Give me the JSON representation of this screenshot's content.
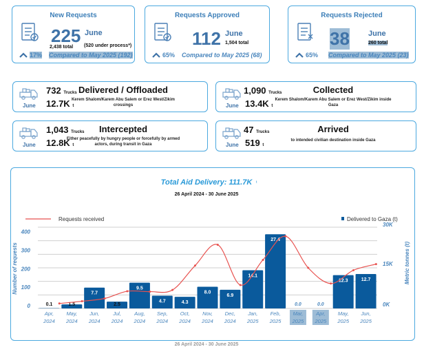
{
  "kpis": [
    {
      "title": "New Requests",
      "value": "225",
      "month": "June",
      "total": "2,438 total",
      "note": "(520 under process*)",
      "pct": "17%",
      "compare": "Compared to May 2025 (192)",
      "icon": "documents-check-icon"
    },
    {
      "title": "Requests Approved",
      "value": "112",
      "month": "June",
      "total": "1,504 total",
      "note": "",
      "pct": "65%",
      "compare": "Compared to May 2025 (68)",
      "icon": "document-magnifier-check-icon"
    },
    {
      "title": "Requests Rejected",
      "value": "38",
      "month": "June",
      "total": "260 total",
      "note": "",
      "pct": "65%",
      "compare": "Compared to May 2025 (23)",
      "icon": "scroll-x-icon"
    }
  ],
  "trucks": [
    {
      "title": "Delivered / Offloaded",
      "trucks": "732",
      "trucks_unit": "Trucks",
      "tonnes": "12.7K",
      "tonnes_unit": "t",
      "month": "June",
      "desc": "Kerem Shalom/Karem Abu Salem or Erez West/Zikim crossings"
    },
    {
      "title": "Collected",
      "trucks": "1,090",
      "trucks_unit": "Trucks",
      "tonnes": "13.4K",
      "tonnes_unit": "t",
      "month": "June",
      "desc": "Kerem Shalom/Karem Abu Salem or Erez West/Zikim inside Gaza"
    },
    {
      "title": "Intercepted",
      "trucks": "1,043",
      "trucks_unit": "Trucks",
      "tonnes": "12.8K",
      "tonnes_unit": "t",
      "month": "June",
      "desc": "Either peacefully by hungry people or forcefully by armed actors, during transit in Gaza"
    },
    {
      "title": "Arrived",
      "trucks": "47",
      "trucks_unit": "Trucks",
      "tonnes": "519",
      "tonnes_unit": "t",
      "month": "June",
      "desc": "to intended civilian destination inside Gaza"
    }
  ],
  "chart_data": {
    "type": "bar",
    "title": "Total Aid Delivery:  111.7K",
    "title_unit": "t",
    "subtitle": "26 April 2024 - 30 June 2025",
    "footer": "26 April 2024 - 30 June 2025",
    "categories": [
      [
        "Apr,",
        "2024"
      ],
      [
        "May,",
        "2024"
      ],
      [
        "Jun,",
        "2024"
      ],
      [
        "Jul,",
        "2024"
      ],
      [
        "Aug,",
        "2024"
      ],
      [
        "Sep,",
        "2024"
      ],
      [
        "Oct,",
        "2024"
      ],
      [
        "Nov,",
        "2024"
      ],
      [
        "Dec,",
        "2024"
      ],
      [
        "Jan,",
        "2025"
      ],
      [
        "Feb,",
        "2025"
      ],
      [
        "Mar,",
        "2025"
      ],
      [
        "Apr,",
        "2025"
      ],
      [
        "May,",
        "2025"
      ],
      [
        "Jun,",
        "2025"
      ]
    ],
    "highlighted_categories": [
      11,
      12
    ],
    "series": [
      {
        "name": "Delivered to Gaza (t)",
        "axis": "right",
        "type": "bar",
        "unit": "K t",
        "values": [
          0.1,
          1.5,
          7.7,
          2.5,
          9.5,
          4.7,
          4.3,
          8.0,
          6.9,
          14.1,
          27.4,
          0.0,
          0.0,
          12.3,
          12.7
        ],
        "labels": [
          "0.1",
          "1.5",
          "7.7",
          "2.5",
          "9.5",
          "4.7",
          "4.3",
          "8.0",
          "6.9",
          "14.1",
          "27.4",
          "0.0",
          "0.0",
          "12.3",
          "12.7"
        ]
      },
      {
        "name": "Requests received",
        "axis": "left",
        "type": "line",
        "values": [
          27,
          39,
          54,
          93,
          91,
          100,
          232,
          345,
          127,
          263,
          391,
          220,
          135,
          207,
          240
        ]
      }
    ],
    "ylabel_left": "Number of requests",
    "ylim_left": [
      0,
      440
    ],
    "yticks_left": [
      "0",
      "100",
      "200",
      "300",
      "400"
    ],
    "ylabel_right": "Metric tonnes (t)",
    "ylim_right": [
      0,
      30
    ],
    "yticks_right": [
      "0K",
      "15K",
      "30K"
    ],
    "legend": {
      "line": "top-left",
      "bar": "top-right"
    },
    "grid": true,
    "colors": {
      "bar": "#0a5a9c",
      "line": "#e8524f",
      "axis_text": "#4a86bd"
    }
  }
}
